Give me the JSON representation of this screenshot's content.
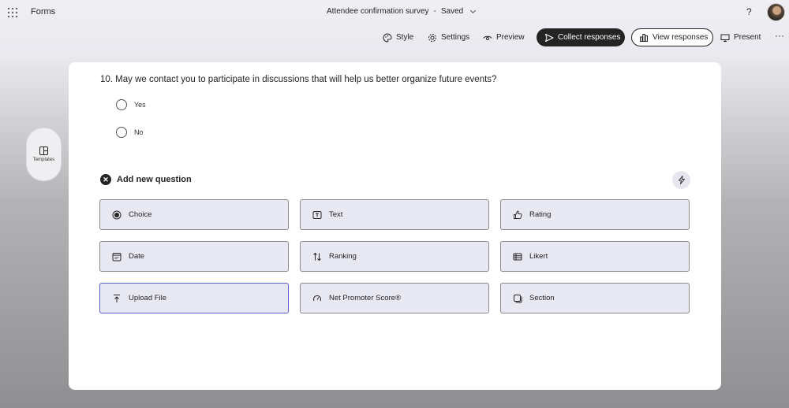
{
  "app": {
    "name": "Forms"
  },
  "document": {
    "title": "Attendee confirmation survey",
    "separator": "-",
    "status": "Saved"
  },
  "header": {
    "help": "?"
  },
  "toolbar": {
    "style": "Style",
    "settings": "Settings",
    "preview": "Preview",
    "collect": "Collect responses",
    "view": "View responses",
    "present": "Present",
    "more": "···"
  },
  "sidebar": {
    "templates": "Templates"
  },
  "question": {
    "title": "10. May we contact you to participate in discussions that will help us better organize future events?",
    "options": [
      "Yes",
      "No"
    ]
  },
  "add_question": {
    "label": "Add new question",
    "types": [
      "Choice",
      "Text",
      "Rating",
      "Date",
      "Ranking",
      "Likert",
      "Upload File",
      "Net Promoter Score®",
      "Section"
    ]
  },
  "colors": {
    "accent": "#5b5fc7",
    "primary_button": "#242424",
    "tile_bg": "#e8e8f3"
  }
}
